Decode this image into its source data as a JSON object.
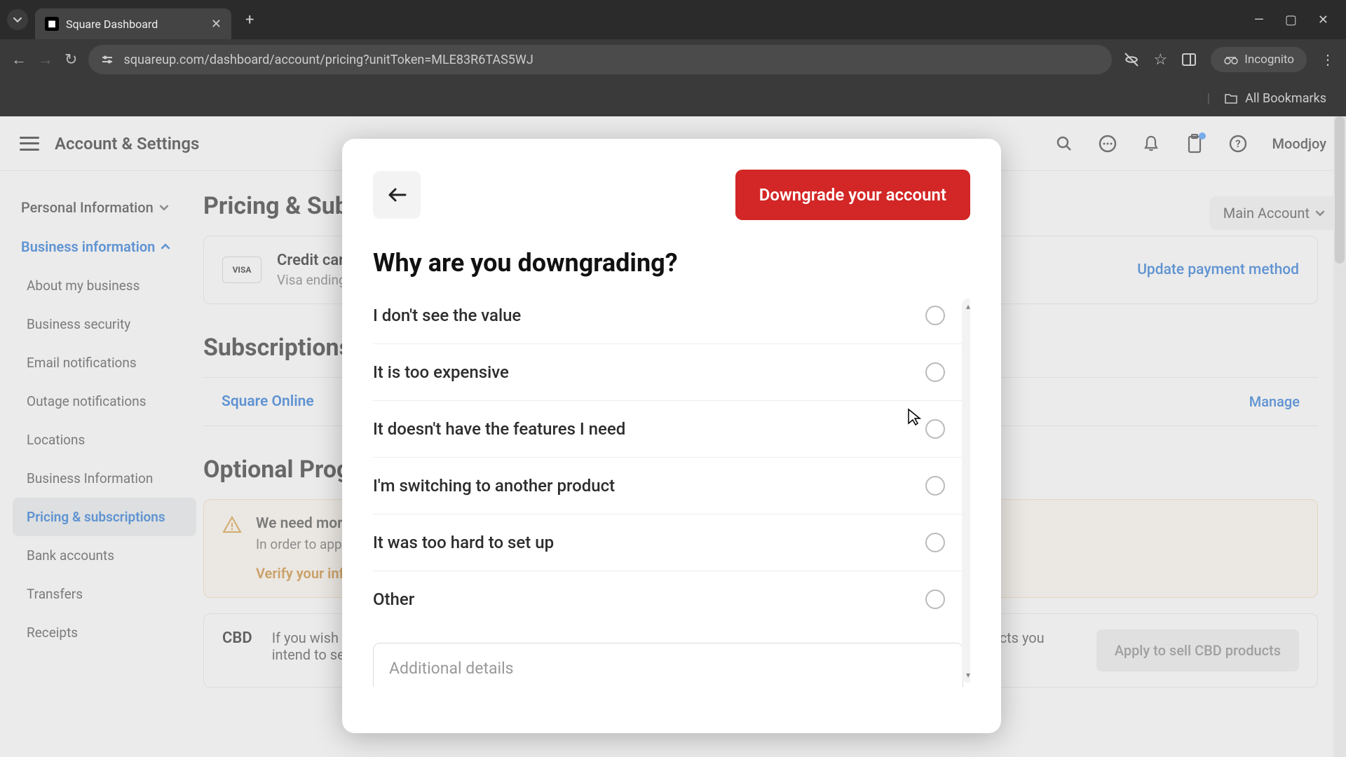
{
  "browser": {
    "tab_title": "Square Dashboard",
    "url": "squareup.com/dashboard/account/pricing?unitToken=MLE83R6TAS5WJ",
    "incognito": "Incognito",
    "bookmarks": "All Bookmarks"
  },
  "header": {
    "title": "Account & Settings",
    "user": "Moodjoy"
  },
  "sidebar": {
    "group1": "Personal Information",
    "group2": "Business information",
    "items": [
      "About my business",
      "Business security",
      "Email notifications",
      "Outage notifications",
      "Locations",
      "Business Information",
      "Pricing & subscriptions",
      "Bank accounts",
      "Transfers",
      "Receipts"
    ]
  },
  "content": {
    "h1": "Pricing & Subscriptions",
    "account_selector": "Main Account",
    "card_title": "Credit card",
    "card_sub": "Visa ending in",
    "update_link": "Update payment method",
    "h2": "Subscriptions",
    "sub_name": "Square Online",
    "manage": "Manage",
    "h3": "Optional Programs",
    "warn_title": "We need more information",
    "warn_body": "In order to apply for this program we need to verify some additional information.",
    "warn_link": "Verify your information",
    "cbd_label": "CBD",
    "cbd_body": "If you wish to sell CBD products with Square, we will need to collect more information on your business and the products you intend to sell.",
    "cbd_btn": "Apply to sell CBD products"
  },
  "modal": {
    "primary": "Downgrade your account",
    "title": "Why are you downgrading?",
    "options": [
      "I don't see the value",
      "It is too expensive",
      "It doesn't have the features I need",
      "I'm switching to another product",
      "It was too hard to set up",
      "Other"
    ],
    "placeholder": "Additional details"
  }
}
